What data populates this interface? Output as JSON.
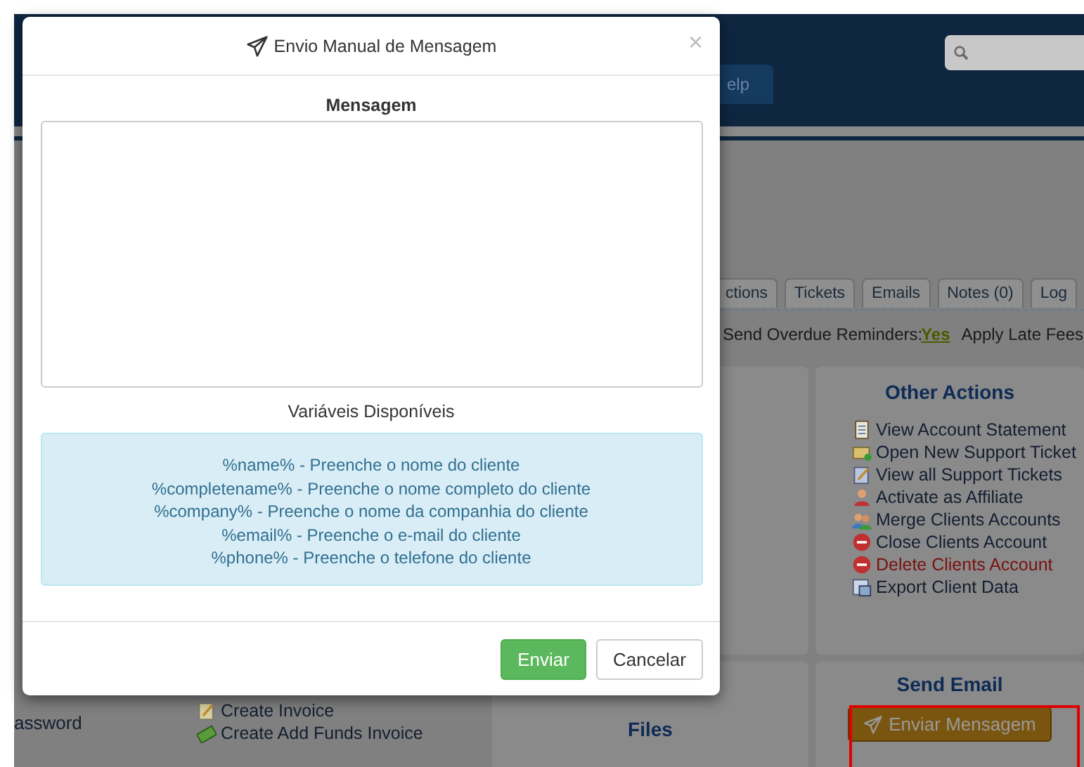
{
  "background": {
    "nav_tab": "elp",
    "tabs": [
      {
        "label": "ctions",
        "selected": false
      },
      {
        "label": "Tickets",
        "selected": false
      },
      {
        "label": "Emails",
        "selected": false
      },
      {
        "label": "Notes (0)",
        "selected": false
      },
      {
        "label": "Log",
        "selected": false
      }
    ],
    "reminders": {
      "label": "Send Overdue Reminders:",
      "value": "Yes",
      "next": "Apply Late Fees"
    },
    "password_link": "assword",
    "invoice_actions": [
      "Create Invoice",
      "Create Add Funds Invoice"
    ],
    "files_title": "Files",
    "other_actions": {
      "title": "Other Actions",
      "items": [
        {
          "label": "View Account Statement",
          "danger": false
        },
        {
          "label": "Open New Support Ticket",
          "danger": false
        },
        {
          "label": "View all Support Tickets",
          "danger": false
        },
        {
          "label": "Activate as Affiliate",
          "danger": false
        },
        {
          "label": "Merge Clients Accounts",
          "danger": false
        },
        {
          "label": "Close Clients Account",
          "danger": false
        },
        {
          "label": "Delete Clients Account",
          "danger": true
        },
        {
          "label": "Export Client Data",
          "danger": false
        }
      ]
    },
    "send_email": {
      "title": "Send Email",
      "button": "Enviar Mensagem",
      "highlighted": true
    }
  },
  "modal": {
    "title": "Envio Manual de Mensagem",
    "close": "×",
    "message_label": "Mensagem",
    "variables_title": "Variáveis Disponíveis",
    "variables": [
      "%name% - Preenche o nome do cliente",
      "%completename% - Preenche o nome completo do cliente",
      "%company% - Preenche o nome da companhia do cliente",
      "%email% - Preenche o e-mail do cliente",
      "%phone% - Preenche o telefone do cliente"
    ],
    "buttons": [
      {
        "label": "Enviar",
        "kind": "primary"
      },
      {
        "label": "Cancelar",
        "kind": "default"
      }
    ]
  }
}
